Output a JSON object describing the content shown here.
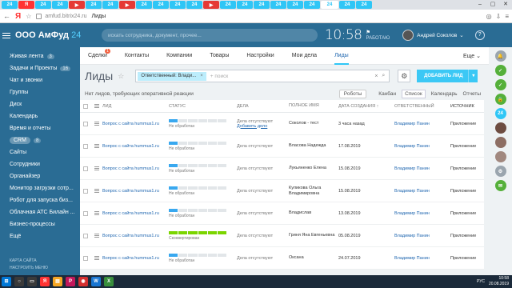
{
  "browser": {
    "tabs": [
      {
        "label": "24",
        "color": "#2fc6f6"
      },
      {
        "label": "Я",
        "color": "#f33"
      },
      {
        "label": "24",
        "color": "#2fc6f6"
      },
      {
        "label": "24",
        "color": "#2fc6f6"
      },
      {
        "label": "▶",
        "color": "#e53935"
      },
      {
        "label": "24",
        "color": "#2fc6f6"
      },
      {
        "label": "24",
        "color": "#2fc6f6"
      },
      {
        "label": "▶",
        "color": "#e53935"
      },
      {
        "label": "24",
        "color": "#2fc6f6"
      },
      {
        "label": "24",
        "color": "#2fc6f6"
      },
      {
        "label": "24",
        "color": "#2fc6f6"
      },
      {
        "label": "24",
        "color": "#2fc6f6"
      },
      {
        "label": "▶",
        "color": "#e53935"
      },
      {
        "label": "24",
        "color": "#2fc6f6"
      },
      {
        "label": "24",
        "color": "#2fc6f6"
      },
      {
        "label": "24",
        "color": "#2fc6f6"
      },
      {
        "label": "24",
        "color": "#2fc6f6"
      },
      {
        "label": "24",
        "color": "#2fc6f6"
      },
      {
        "label": "24",
        "color": "#2fc6f6"
      },
      {
        "label": "24",
        "color": "#2fc6f6"
      },
      {
        "label": "24",
        "color": "#2fc6f6"
      },
      {
        "label": "24",
        "color": "#2fc6f6"
      }
    ],
    "active_tab": "24",
    "url": "amfud.bitrix24.ru",
    "page_title": "Лиды"
  },
  "header": {
    "logo": "ООО АмФуд",
    "logo_num": "24",
    "search_placeholder": "искать сотрудника, документ, прочее...",
    "clock": "10:58",
    "work_flag": "⚑",
    "work_status": "РАБОТАЮ",
    "user_name": "Андрей Соколов",
    "user_caret": "⌄",
    "help": "?"
  },
  "sidebar": {
    "items": [
      {
        "label": "Живая лента",
        "count": "3"
      },
      {
        "label": "Задачи и Проекты",
        "count": "16"
      },
      {
        "label": "Чат и звонки",
        "count": ""
      },
      {
        "label": "Группы",
        "count": ""
      },
      {
        "label": "Диск",
        "count": ""
      },
      {
        "label": "Календарь",
        "count": ""
      },
      {
        "label": "Время и отчеты",
        "count": ""
      },
      {
        "label": "CRM",
        "count": "8"
      },
      {
        "label": "Сайты",
        "count": ""
      },
      {
        "label": "Сотрудники",
        "count": ""
      },
      {
        "label": "Органайзер",
        "count": ""
      },
      {
        "label": "Монитор загрузки сотр...",
        "count": ""
      },
      {
        "label": "Робот для запуска биз...",
        "count": ""
      },
      {
        "label": "Облачная АТС Билайн ...",
        "count": ""
      },
      {
        "label": "Бизнес-процессы",
        "count": ""
      },
      {
        "label": "Ещё",
        "count": ""
      }
    ],
    "active_index": 7,
    "bottom_1": "КАРТА САЙТА",
    "bottom_2": "НАСТРОИТЬ МЕНЮ"
  },
  "topnav": {
    "items": [
      "Сделки",
      "Контакты",
      "Компании",
      "Товары",
      "Настройки",
      "Мои дела",
      "Лиды"
    ],
    "selected": "Лиды",
    "deals_badge": "1",
    "more": "Еще ⌄"
  },
  "page": {
    "title": "Лиды",
    "star": "☆",
    "filter_chip": "Ответственный: Влади...",
    "filter_chip_close": "×",
    "filter_placeholder": "+ поиск",
    "filter_clear": "×",
    "filter_search_icon": "⌕",
    "gear": "⚙",
    "add_button": "ДОБАВИТЬ ЛИД",
    "add_dropdown": "▾",
    "info": "Нет лидов, требующих оперативной реакции",
    "robots": "Роботы",
    "views": [
      "Канбан",
      "Список",
      "Календарь",
      "Отчеты"
    ],
    "active_view": "Список"
  },
  "table": {
    "headers": [
      "ЛИД",
      "СТАТУС",
      "ДЕЛА",
      "ПОЛНОЕ ИМЯ",
      "ДАТА СОЗДАНИЯ ↑",
      "ОТВЕТСТВЕННЫЙ",
      "ИСТОЧНИК"
    ],
    "rows": [
      {
        "lead": "Вопрос с сайта hummus1.ru",
        "status": "Не обработан",
        "bar": "new",
        "deals": "Дела отсутствуют",
        "deals_link": "Добавить дело",
        "name": "Соколов - тест",
        "date": "3 часа назад",
        "resp": "Владимир Панин",
        "src": "Приложение"
      },
      {
        "lead": "Вопрос с сайта hummus1.ru",
        "status": "Не обработан",
        "bar": "new",
        "deals": "Дела отсутствуют",
        "deals_link": "",
        "name": "Власова Надежда",
        "date": "17.08.2019",
        "resp": "Владимир Панин",
        "src": "Приложение"
      },
      {
        "lead": "Вопрос с сайта hummus1.ru",
        "status": "Не обработан",
        "bar": "new",
        "deals": "Дела отсутствуют",
        "deals_link": "",
        "name": "Лукьяненко Елена",
        "date": "15.08.2019",
        "resp": "Владимир Панин",
        "src": "Приложение"
      },
      {
        "lead": "Вопрос с сайта hummus1.ru",
        "status": "Не обработан",
        "bar": "new",
        "deals": "Дела отсутствуют",
        "deals_link": "",
        "name": "Куликова Ольга Владимировна",
        "date": "15.08.2019",
        "resp": "Владимир Панин",
        "src": "Приложение"
      },
      {
        "lead": "Вопрос с сайта hummus1.ru",
        "status": "Не обработан",
        "bar": "new",
        "deals": "Дела отсутствуют",
        "deals_link": "",
        "name": "Владислав",
        "date": "13.08.2019",
        "resp": "Владимир Панин",
        "src": "Приложение"
      },
      {
        "lead": "Вопрос с сайта hummus1.ru",
        "status": "Сконвертирован",
        "bar": "full",
        "deals": "Дела отсутствуют",
        "deals_link": "",
        "name": "Гриня Яна Евгеньевна",
        "date": "05.08.2019",
        "resp": "Владимир Панин",
        "src": "Приложение"
      },
      {
        "lead": "Вопрос с сайта hummus1.ru",
        "status": "Не обработан",
        "bar": "new",
        "deals": "Дела отсутствуют",
        "deals_link": "",
        "name": "Оксана",
        "date": "24.07.2019",
        "resp": "Владимир Панин",
        "src": "Приложение"
      }
    ]
  },
  "rightbar": {
    "icons": [
      {
        "name": "bell-icon",
        "glyph": "🔔",
        "color": "#9aa5ae"
      },
      {
        "name": "check-icon",
        "glyph": "✓",
        "color": "#55b03a"
      },
      {
        "name": "check-icon",
        "glyph": "✓",
        "color": "#55b03a"
      },
      {
        "name": "lock-icon",
        "glyph": "🔒",
        "color": "#55b03a"
      },
      {
        "name": "bitrix-icon",
        "glyph": "24",
        "color": "#2fc6f6"
      },
      {
        "name": "avatar-icon",
        "glyph": "",
        "color": "#6d4c41"
      },
      {
        "name": "avatar-icon",
        "glyph": "",
        "color": "#8d6e63"
      },
      {
        "name": "avatar-icon",
        "glyph": "",
        "color": "#a1887f"
      },
      {
        "name": "gear-icon",
        "glyph": "⚙",
        "color": "#9aa5ae"
      },
      {
        "name": "chat-icon",
        "glyph": "✉",
        "color": "#55b03a"
      }
    ]
  },
  "taskbar": {
    "lang": "РУС",
    "time": "10:58",
    "date": "20.08.2019"
  }
}
